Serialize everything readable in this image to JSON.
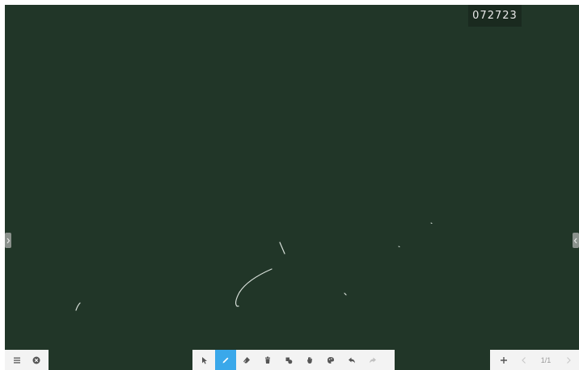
{
  "board": {
    "background_color": "#213628",
    "stroke_color": "#d8e0da",
    "code": "072723"
  },
  "handles": {
    "left": {
      "icon": "chevron-right-icon"
    },
    "right": {
      "icon": "chevron-left-icon"
    }
  },
  "left_toolbar": {
    "items": [
      {
        "icon": "menu-icon"
      },
      {
        "icon": "close-circle-icon"
      }
    ]
  },
  "main_toolbar": {
    "active_tool": "pen",
    "accent_color": "#3aa8ea",
    "items": [
      {
        "icon": "select-arrow-icon"
      },
      {
        "icon": "pen-icon"
      },
      {
        "icon": "eraser-icon"
      },
      {
        "icon": "trash-icon"
      },
      {
        "icon": "shapes-icon"
      },
      {
        "icon": "hand-icon"
      },
      {
        "icon": "palette-icon"
      },
      {
        "icon": "undo-icon"
      },
      {
        "icon": "redo-icon"
      }
    ]
  },
  "page_nav": {
    "page_label": "1/1",
    "items": [
      {
        "icon": "add-page-icon"
      },
      {
        "icon": "prev-page-icon"
      },
      {
        "icon": "next-page-icon"
      }
    ]
  }
}
